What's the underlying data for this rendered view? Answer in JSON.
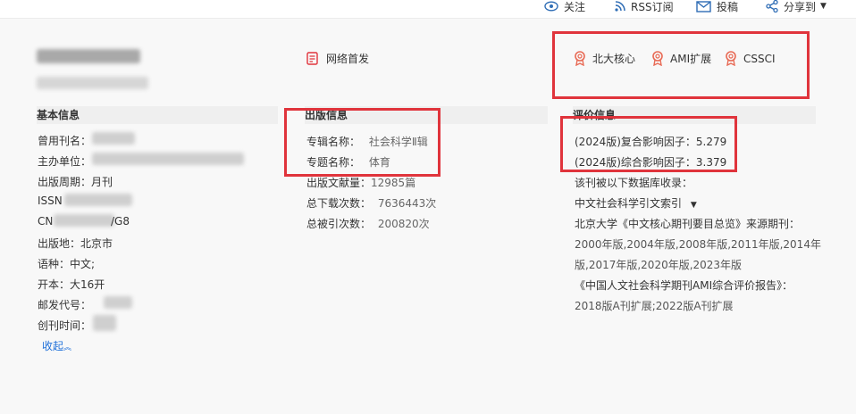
{
  "topbar": {
    "follow": "关注",
    "rss": "RSS订阅",
    "submit": "投稿",
    "share": "分享到"
  },
  "journal": {
    "online_first": "网络首发"
  },
  "badges": [
    "北大核心",
    "AMI扩展",
    "CSSCI"
  ],
  "basic": {
    "heading": "基本信息",
    "former_name_label": "曾用刊名：",
    "sponsor_label": "主办单位：",
    "cycle_label": "出版周期：",
    "cycle_value": "月刊",
    "issn_label": "ISSN",
    "cn_label": "CN",
    "cn_value_tail": "/G8",
    "place_label": "出版地：",
    "place_value": "北京市",
    "language_label": "语种：",
    "language_value": "中文;",
    "format_label": "开本：",
    "format_value": "大16开",
    "postal_label": "邮发代号：",
    "founded_label": "创刊时间：",
    "collapse": "收起"
  },
  "publish": {
    "heading": "出版信息",
    "series_label": "专辑名称：",
    "series_value": "社会科学Ⅱ辑",
    "topic_label": "专题名称：",
    "topic_value": "体育",
    "docs_label": "出版文献量：",
    "docs_value": "12985篇",
    "downloads_label": "总下载次数：",
    "downloads_value": "7636443次",
    "citations_label": "总被引次数：",
    "citations_value": "200820次"
  },
  "evaluation": {
    "heading": "评价信息",
    "composite_if": "(2024版)复合影响因子：5.279",
    "comprehensive_if": "(2024版)综合影响因子：3.379",
    "db_intro": "该刊被以下数据库收录：",
    "db_selected": "中文社会科学引文索引",
    "pku_title": "北京大学《中文核心期刊要目总览》来源期刊：",
    "pku_years_1": "2000年版,2004年版,2008年版,2011年版,2014年",
    "pku_years_2": "版,2017年版,2020年版,2023年版",
    "ami_title": "《中国人文社会科学期刊AMI综合评价报告》：",
    "ami_years": "2018版A刊扩展;2022版A刊扩展"
  },
  "colors": {
    "accent_red": "#e0343c",
    "badge_orange": "#e86a55",
    "link_blue": "#1e6fd9",
    "icon_blue": "#2f6db5"
  }
}
